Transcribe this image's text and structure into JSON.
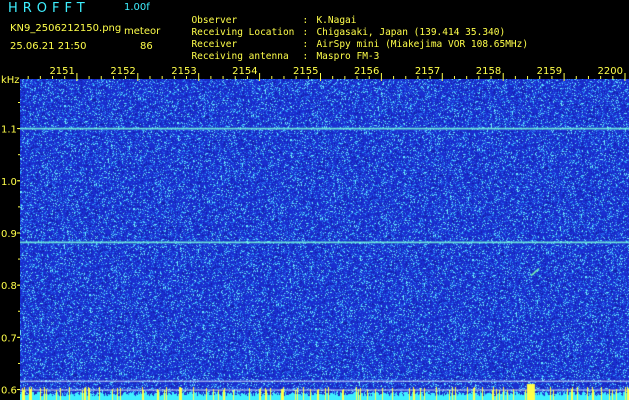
{
  "header": {
    "app_name": "HROFFT",
    "version": "1.00f",
    "filename": "KN9_2506212150.png",
    "meteor_label": "meteor",
    "timestamp": "25.06.21 21:50",
    "meteor_count": "86"
  },
  "station_info": [
    {
      "label": "Observer",
      "value": "K.Nagai"
    },
    {
      "label": "Receiving Location",
      "value": "Chigasaki, Japan (139.414 35.340)"
    },
    {
      "label": "Receiver",
      "value": "AirSpy mini (Miakejima VOR 108.65MHz)"
    },
    {
      "label": "Receiving antenna",
      "value": "Maspro FM-3"
    }
  ],
  "spectrogram": {
    "y_unit": "kHz",
    "y_ticks": [
      "1.1",
      "1.0",
      "0.9",
      "0.8",
      "0.7",
      "0.6"
    ],
    "y_range": [
      0.58,
      1.195
    ],
    "x_ticks": [
      "2151",
      "2152",
      "2153",
      "2154",
      "2155",
      "2156",
      "2157",
      "2158",
      "2159",
      "2200"
    ],
    "x_range": [
      "21:50",
      "22:00"
    ],
    "background_color": "#1a2ed0",
    "noise_color": "#3ef0ff",
    "axis_text_color": "#ffff4a",
    "carrier_lines_khz": [
      1.1,
      0.882
    ],
    "reference_lines_khz": [
      0.617,
      0.6
    ],
    "meteor_echo": {
      "time": "21:58:45",
      "freq_khz_start": 0.818,
      "freq_khz_end": 0.832
    }
  }
}
